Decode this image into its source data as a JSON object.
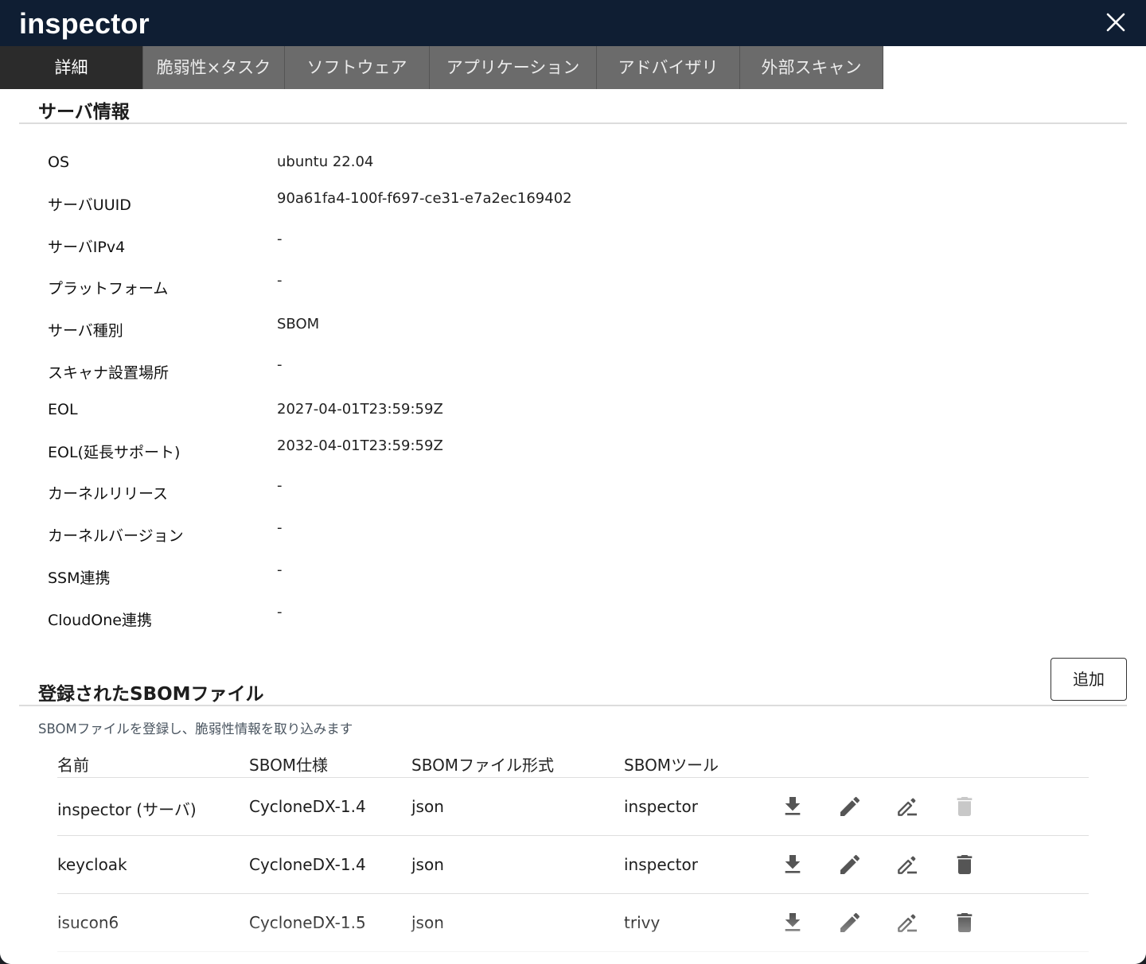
{
  "header": {
    "title": "inspector",
    "close_icon": "close-icon"
  },
  "tabs": [
    {
      "label": "詳細",
      "active": true
    },
    {
      "label": "脆弱性×タスク",
      "active": false
    },
    {
      "label": "ソフトウェア",
      "active": false
    },
    {
      "label": "アプリケーション",
      "active": false
    },
    {
      "label": "アドバイザリ",
      "active": false
    },
    {
      "label": "外部スキャン",
      "active": false
    }
  ],
  "server_info": {
    "title": "サーバ情報",
    "rows": [
      {
        "label": "OS",
        "value": "ubuntu 22.04"
      },
      {
        "label": "サーバUUID",
        "value": "90a61fa4-100f-f697-ce31-e7a2ec169402"
      },
      {
        "label": "サーバIPv4",
        "value": "-"
      },
      {
        "label": "プラットフォーム",
        "value": "-"
      },
      {
        "label": "サーバ種別",
        "value": "SBOM"
      },
      {
        "label": "スキャナ設置場所",
        "value": "-"
      },
      {
        "label": "EOL",
        "value": "2027-04-01T23:59:59Z"
      },
      {
        "label": "EOL(延長サポート)",
        "value": "2032-04-01T23:59:59Z"
      },
      {
        "label": "カーネルリリース",
        "value": "-"
      },
      {
        "label": "カーネルバージョン",
        "value": "-"
      },
      {
        "label": "SSM連携",
        "value": "-"
      },
      {
        "label": "CloudOne連携",
        "value": "-"
      }
    ]
  },
  "sbom": {
    "title": "登録されたSBOMファイル",
    "add_label": "追加",
    "description": "SBOMファイルを登録し、脆弱性情報を取り込みます",
    "columns": [
      "名前",
      "SBOM仕様",
      "SBOMファイル形式",
      "SBOMツール"
    ],
    "rows": [
      {
        "name": "inspector (サーバ)",
        "spec": "CycloneDX-1.4",
        "format": "json",
        "tool": "inspector",
        "delete_enabled": false
      },
      {
        "name": "keycloak",
        "spec": "CycloneDX-1.4",
        "format": "json",
        "tool": "inspector",
        "delete_enabled": true
      },
      {
        "name": "isucon6",
        "spec": "CycloneDX-1.5",
        "format": "json",
        "tool": "trivy",
        "delete_enabled": true
      }
    ],
    "row_icons": [
      "download-icon",
      "pencil-icon",
      "rename-icon",
      "trash-icon"
    ]
  },
  "colors": {
    "titlebar": "#0f1e33",
    "tab_inactive": "#6b6b6b",
    "tab_active": "#2b2b2b",
    "icon": "#555555",
    "icon_disabled": "#c8c8c8"
  }
}
